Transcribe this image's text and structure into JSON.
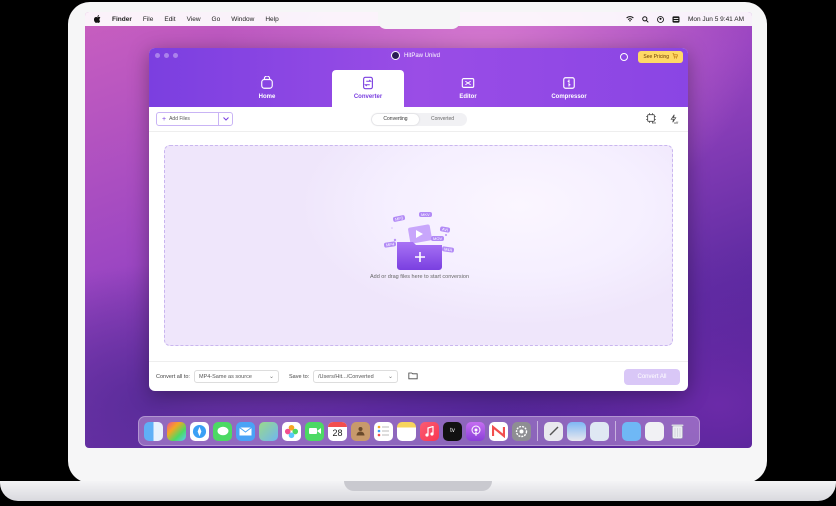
{
  "menubar": {
    "apple": "",
    "items": [
      "Finder",
      "File",
      "Edit",
      "View",
      "Go",
      "Window",
      "Help"
    ],
    "datetime": "Mon Jun 5  9:41 AM"
  },
  "app": {
    "title": "HitPaw Univd",
    "pricing": "See Pricing",
    "tabs": [
      {
        "label": "Home"
      },
      {
        "label": "Converter"
      },
      {
        "label": "Editor"
      },
      {
        "label": "Compressor"
      }
    ],
    "add_files": "Add Files",
    "segments": [
      "Converting",
      "Converted"
    ],
    "toolbar_icons": [
      {
        "name": "hardware-acceleration-icon",
        "badge": "on"
      },
      {
        "name": "speed-icon",
        "badge": "off"
      }
    ],
    "drop_text": "Add or drag files here to start conversion",
    "drop_art_labels": [
      "MP3",
      "MKV",
      "AVI",
      "MP4",
      "MOV",
      "M4A"
    ],
    "convert_all_to_label": "Convert all to:",
    "format_value": "MP4-Same as source",
    "save_to_label": "Save to:",
    "save_path": "/Users/Hit.../Converted",
    "convert_all_button": "Convert All"
  },
  "dock": {
    "calendar_day": "28",
    "tv_label": "tv"
  },
  "colors": {
    "accent": "#7a3fe0",
    "pricing_bg": "#ffd966"
  }
}
